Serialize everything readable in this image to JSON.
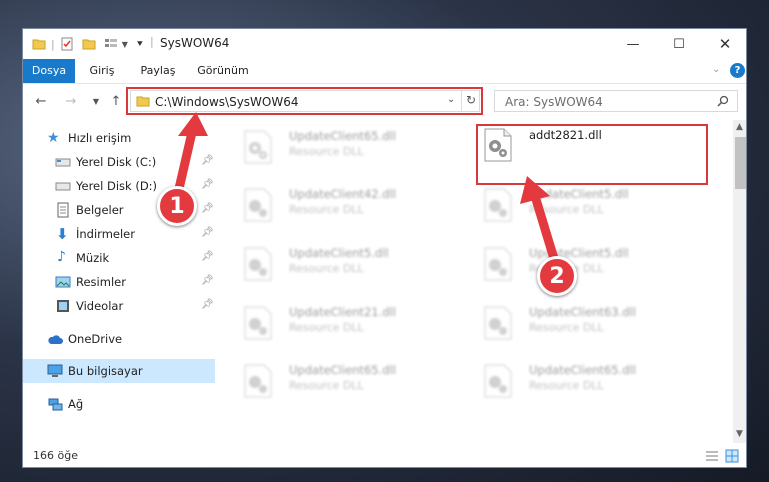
{
  "window": {
    "title": "SysWOW64"
  },
  "ribbon": {
    "tabs": [
      "Dosya",
      "Giriş",
      "Paylaş",
      "Görünüm"
    ]
  },
  "address": {
    "path": "C:\\Windows\\SysWOW64"
  },
  "search": {
    "placeholder": "Ara: SysWOW64"
  },
  "sidebar": {
    "items": [
      {
        "label": "Hızlı erişim"
      },
      {
        "label": "Yerel Disk (C:)"
      },
      {
        "label": "Yerel Disk (D:)"
      },
      {
        "label": "Belgeler"
      },
      {
        "label": "İndirmeler"
      },
      {
        "label": "Müzik"
      },
      {
        "label": "Resimler"
      },
      {
        "label": "Videolar"
      },
      {
        "label": "OneDrive"
      },
      {
        "label": "Bu bilgisayar"
      },
      {
        "label": "Ağ"
      }
    ]
  },
  "files": [
    {
      "name": "UpdateClient65.dll",
      "desc": "Resource DLL"
    },
    {
      "name": "addt2821.dll",
      "desc": ""
    },
    {
      "name": "UpdateClient42.dll",
      "desc": "Resource DLL"
    },
    {
      "name": "UpdateClient5.dll",
      "desc": "Resource DLL"
    },
    {
      "name": "UpdateClient5.dll",
      "desc": "Resource DLL"
    },
    {
      "name": "UpdateClient5.dll",
      "desc": "Resource DLL"
    },
    {
      "name": "UpdateClient21.dll",
      "desc": "Resource DLL"
    },
    {
      "name": "UpdateClient63.dll",
      "desc": "Resource DLL"
    },
    {
      "name": "UpdateClient65.dll",
      "desc": "Resource DLL"
    },
    {
      "name": "UpdateClient65.dll",
      "desc": "Resource DLL"
    }
  ],
  "status": {
    "count": "166 öğe"
  },
  "annotations": {
    "step1": "1",
    "step2": "2"
  },
  "colors": {
    "accent": "#1979ca",
    "highlight": "#d9383a",
    "selected": "#cce8ff"
  }
}
